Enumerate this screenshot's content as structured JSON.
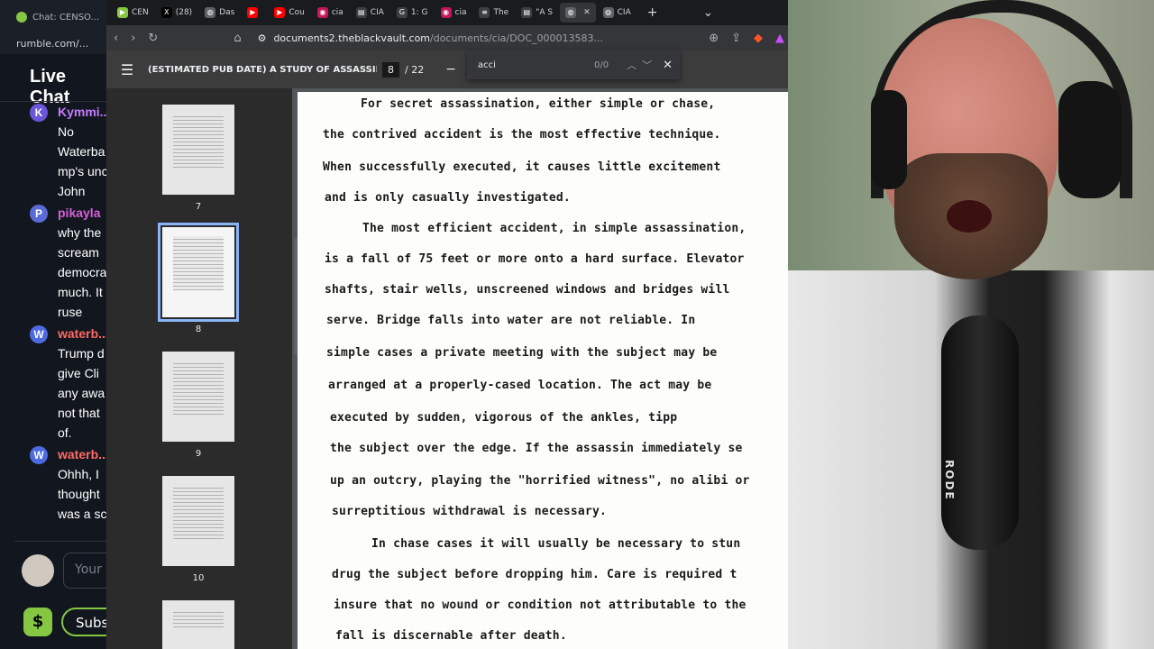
{
  "chat_window": {
    "tab_title": "Chat: CENSO...",
    "url": "rumble.com/...",
    "title": "Live Chat",
    "messages": [
      {
        "avatar": "K",
        "user": "Kymmi...",
        "lines": [
          "No",
          "Waterba",
          "mp's unc",
          "John"
        ]
      },
      {
        "avatar": "P",
        "user": "pikayla",
        "lines": [
          "why the",
          "scream",
          "democra",
          "much. It",
          "ruse"
        ]
      },
      {
        "avatar": "W",
        "user": "waterb...",
        "lines": [
          "Trump d",
          "give Cli",
          "any awa",
          "not that",
          "of."
        ]
      },
      {
        "avatar": "W",
        "user": "waterb...",
        "lines": [
          "Ohhh, I",
          "thought",
          "was a sc"
        ]
      }
    ],
    "input_placeholder": "Your mess",
    "tip_icon": "$",
    "subscribe_label": "Subs"
  },
  "browser": {
    "tabs": [
      {
        "label": "CEN",
        "icon": "rumble-icon"
      },
      {
        "label": "(28)",
        "icon": "x-icon"
      },
      {
        "label": "Das",
        "icon": "globe-icon"
      },
      {
        "label": "",
        "icon": "youtube-icon"
      },
      {
        "label": "Cou",
        "icon": "youtube-icon"
      },
      {
        "label": "cia",
        "icon": "record-icon"
      },
      {
        "label": "CIA",
        "icon": "page-icon"
      },
      {
        "label": "1: G",
        "icon": "g-icon"
      },
      {
        "label": "cia",
        "icon": "record-icon"
      },
      {
        "label": "The",
        "icon": "list-icon"
      },
      {
        "label": "\"A S",
        "icon": "page-icon"
      },
      {
        "label": "",
        "icon": "globe-icon",
        "active": true
      },
      {
        "label": "CIA",
        "icon": "globe-icon"
      }
    ],
    "new_tab": "+",
    "address": {
      "host": "documents2.theblackvault.com",
      "path": "/documents/cia/DOC_000013583..."
    }
  },
  "pdf": {
    "title": "(ESTIMATED PUB DATE) A STUDY OF ASSASSINATI...",
    "current_page": "8",
    "total_pages": "/ 22",
    "find": {
      "term": "acci",
      "count": "0/0"
    },
    "thumbnails": [
      "7",
      "8",
      "9",
      "10"
    ],
    "text_lines": [
      "For secret assassination, either simple or chase,",
      "the contrived accident is the most effective technique.",
      "When successfully executed, it causes little excitement",
      "and is only casually investigated.",
      "The most efficient accident, in simple assassination,",
      "is a fall of 75 feet or more onto a hard surface.  Elevator",
      "shafts, stair wells, unscreened windows and bridges will",
      "serve.  Bridge falls into water are not reliable.  In",
      "simple cases a private meeting with the subject may be",
      "arranged at a properly-cased location.  The act may be",
      "executed by sudden, vigorous           of the ankles, tipp",
      "the subject over the edge.  If the assassin immediately se",
      "up an outcry, playing the \"horrified witness\", no alibi or",
      "surreptitious withdrawal is necessary.",
      "In chase cases it will usually be necessary to stun",
      "drug the subject before dropping him.  Care is required t",
      "insure that no wound or condition not attributable to the",
      "fall is discernable after death."
    ]
  },
  "webcam": {
    "mic_brand": "RODE"
  }
}
